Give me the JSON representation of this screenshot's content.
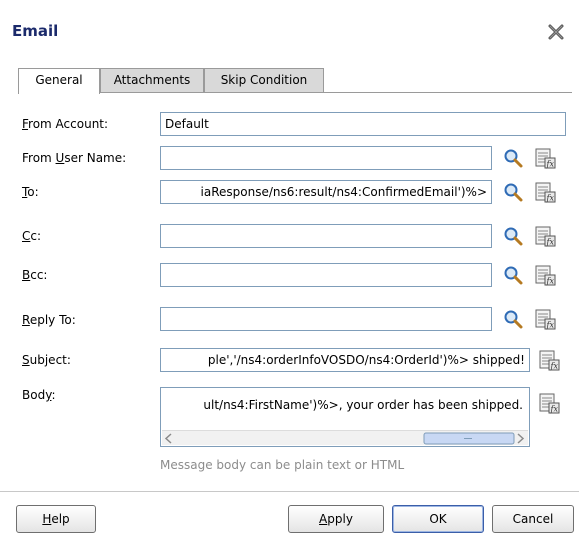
{
  "dialog": {
    "title": "Email",
    "close_icon": "close-x-icon"
  },
  "tabs": [
    {
      "label": "General",
      "active": true
    },
    {
      "label": "Attachments",
      "active": false
    },
    {
      "label": "Skip Condition",
      "active": false
    }
  ],
  "form": {
    "from_account": {
      "mnemonic": "F",
      "rest": "rom Account:",
      "value": "Default"
    },
    "from_user_name": {
      "pre": "From ",
      "mnemonic": "U",
      "rest": "ser Name:",
      "value": ""
    },
    "to": {
      "mnemonic": "T",
      "rest": "o:",
      "value": "iaResponse/ns6:result/ns4:ConfirmedEmail')%>"
    },
    "cc": {
      "mnemonic": "C",
      "rest": "c:",
      "value": ""
    },
    "bcc": {
      "mnemonic": "B",
      "rest": "cc:",
      "value": ""
    },
    "reply_to": {
      "mnemonic": "R",
      "rest": "eply To:",
      "value": ""
    },
    "subject": {
      "mnemonic": "S",
      "rest": "ubject:",
      "value": "ple','/ns4:orderInfoVOSDO/ns4:OrderId')%> shipped!"
    },
    "body": {
      "pre": "Bod",
      "mnemonic": "y",
      "rest": ":",
      "value": "ult/ns4:FirstName')%>, your order has been shipped."
    },
    "body_hint": "Message body can be plain text or HTML"
  },
  "icons": {
    "search": "search-magnifier-icon",
    "expression_builder": "expression-builder-icon"
  },
  "buttons": {
    "help": {
      "mnemonic": "H",
      "rest": "elp"
    },
    "apply": {
      "mnemonic": "A",
      "rest": "pply"
    },
    "ok": "OK",
    "cancel": "Cancel"
  }
}
